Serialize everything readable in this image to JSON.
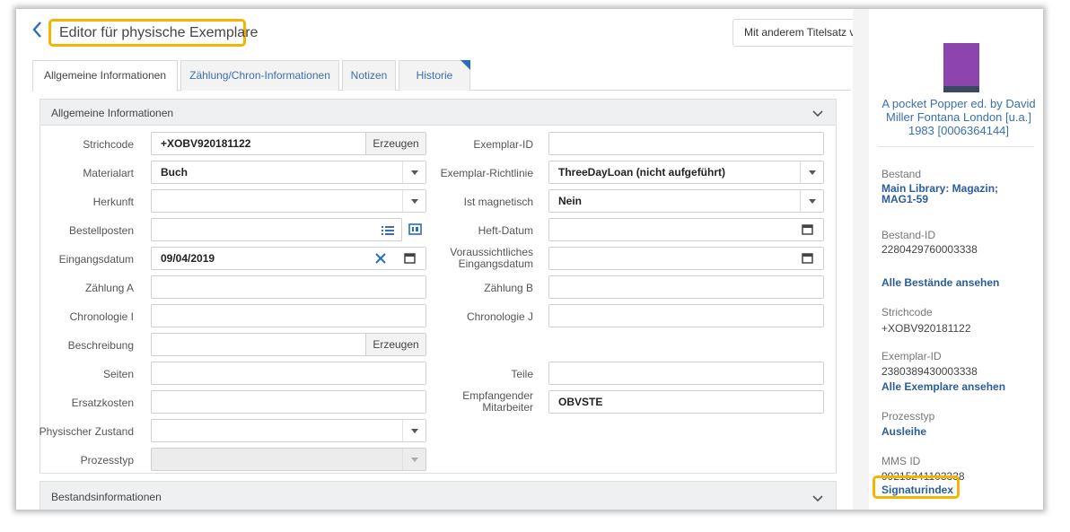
{
  "header": {
    "title": "Editor für physische Exemplare",
    "other_button": "Mit anderem Titelsatz v"
  },
  "tabs": [
    {
      "label": "Allgemeine Informationen"
    },
    {
      "label": "Zählung/Chron-Informationen"
    },
    {
      "label": "Notizen"
    },
    {
      "label": "Historie"
    }
  ],
  "section_general": {
    "title": "Allgemeine Informationen"
  },
  "section_holdings": {
    "title": "Bestandsinformationen"
  },
  "form": {
    "strichcode": {
      "label": "Strichcode",
      "value": "+XOBV920181122",
      "button": "Erzeugen"
    },
    "materialart": {
      "label": "Materialart",
      "value": "Buch"
    },
    "herkunft": {
      "label": "Herkunft",
      "value": ""
    },
    "bestellposten": {
      "label": "Bestellposten",
      "value": ""
    },
    "eingangsdatum": {
      "label": "Eingangsdatum",
      "value": "09/04/2019"
    },
    "zaehlung_a": {
      "label": "Zählung A",
      "value": ""
    },
    "chronologie_i": {
      "label": "Chronologie I",
      "value": ""
    },
    "beschreibung": {
      "label": "Beschreibung",
      "value": "",
      "button": "Erzeugen"
    },
    "seiten": {
      "label": "Seiten",
      "value": ""
    },
    "ersatzkosten": {
      "label": "Ersatzkosten",
      "value": ""
    },
    "physischer_zustand": {
      "label": "Physischer Zustand",
      "value": ""
    },
    "prozesstyp": {
      "label": "Prozesstyp",
      "value": ""
    },
    "exemplar_id": {
      "label": "Exemplar-ID",
      "value": ""
    },
    "exemplar_richtlinie": {
      "label": "Exemplar-Richtlinie",
      "value": "ThreeDayLoan (nicht aufgeführt)"
    },
    "ist_magnetisch": {
      "label": "Ist magnetisch",
      "value": "Nein"
    },
    "heft_datum": {
      "label": "Heft-Datum",
      "value": ""
    },
    "vorauss_eingangsdatum": {
      "label_line1": "Voraussichtliches",
      "label_line2": "Eingangsdatum",
      "value": ""
    },
    "zaehlung_b": {
      "label": "Zählung B",
      "value": ""
    },
    "chronologie_j": {
      "label": "Chronologie J",
      "value": ""
    },
    "teile": {
      "label": "Teile",
      "value": ""
    },
    "empfangender_mitarbeiter": {
      "label_line1": "Empfangender",
      "label_line2": "Mitarbeiter",
      "value": "OBVSTE"
    }
  },
  "side": {
    "book_title": "A pocket Popper ed. by David Miller Fontana London [u.a.] 1983 [0006364144]",
    "bestand_label": "Bestand",
    "bestand_value": "Main Library: Magazin; MAG1-59",
    "bestand_id_label": "Bestand-ID",
    "bestand_id_value": "2280429760003338",
    "alle_bestaende": "Alle Bestände ansehen",
    "strichcode_label": "Strichcode",
    "strichcode_value": "+XOBV920181122",
    "exemplar_id_label": "Exemplar-ID",
    "exemplar_id_value": "2380389430003338",
    "alle_exemplare": "Alle Exemplare ansehen",
    "prozesstyp_label": "Prozesstyp",
    "prozesstyp_value": "Ausleihe",
    "mms_label": "MMS ID",
    "mms_value": "99215241103338",
    "signaturindex": "Signaturindex"
  },
  "colors": {
    "highlight": "#f5b400",
    "link": "#3a6fb0",
    "thumbnail": "#8e44ad"
  }
}
